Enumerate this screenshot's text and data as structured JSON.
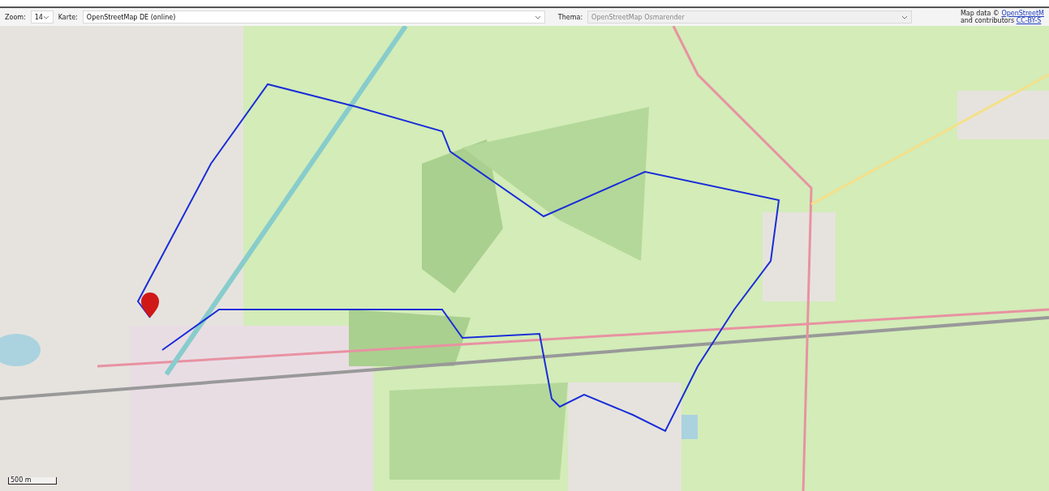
{
  "toolbar": {
    "zoom": {
      "label": "Zoom:",
      "value": "14"
    },
    "map_select": {
      "label": "Karte:",
      "value": "OpenStreetMap DE (online)",
      "disabled": false
    },
    "theme_select": {
      "label": "Thema:",
      "value": "OpenStreetMap Osmarender",
      "disabled": true
    },
    "attribution": {
      "line_1": "Map data ©",
      "link_1": "OpenStreetM",
      "line_2": "and contributors",
      "link_2": "CC-BY-S"
    }
  },
  "map": {
    "scale": "500 m"
  }
}
